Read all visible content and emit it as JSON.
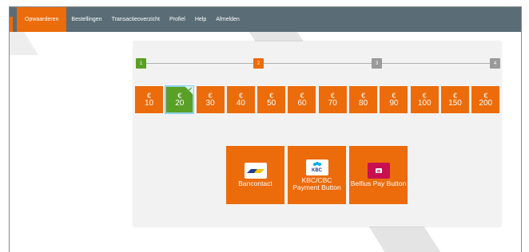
{
  "nav": {
    "items": [
      {
        "label": "Opwaarderen",
        "active": true
      },
      {
        "label": "Bestellingen",
        "active": false
      },
      {
        "label": "Transactieoverzicht",
        "active": false
      },
      {
        "label": "Profiel",
        "active": false
      },
      {
        "label": "Help",
        "active": false
      },
      {
        "label": "Afmelden",
        "active": false
      }
    ]
  },
  "steps": [
    {
      "label": "1",
      "color": "#5aa026"
    },
    {
      "label": "2",
      "color": "#ec6b0a"
    },
    {
      "label": "3",
      "color": "#9a9a9a"
    },
    {
      "label": "4",
      "color": "#9a9a9a"
    }
  ],
  "amounts": {
    "currency": "€",
    "values": [
      "10",
      "20",
      "30",
      "40",
      "50",
      "60",
      "70",
      "80",
      "90",
      "100",
      "150",
      "200"
    ],
    "selected": "20"
  },
  "payment_methods": [
    {
      "label": "Bancontact",
      "icon": "bancontact-logo-icon"
    },
    {
      "label": "KBC/CBC Payment Button",
      "icon": "kbc-logo-icon",
      "logo_text": "KBC"
    },
    {
      "label": "Belfius Pay Button",
      "icon": "belfius-logo-icon"
    }
  ],
  "colors": {
    "accent": "#ec6b0a",
    "nav": "#5a6d76",
    "selected": "#5aa026",
    "belfius": "#c8104f"
  }
}
